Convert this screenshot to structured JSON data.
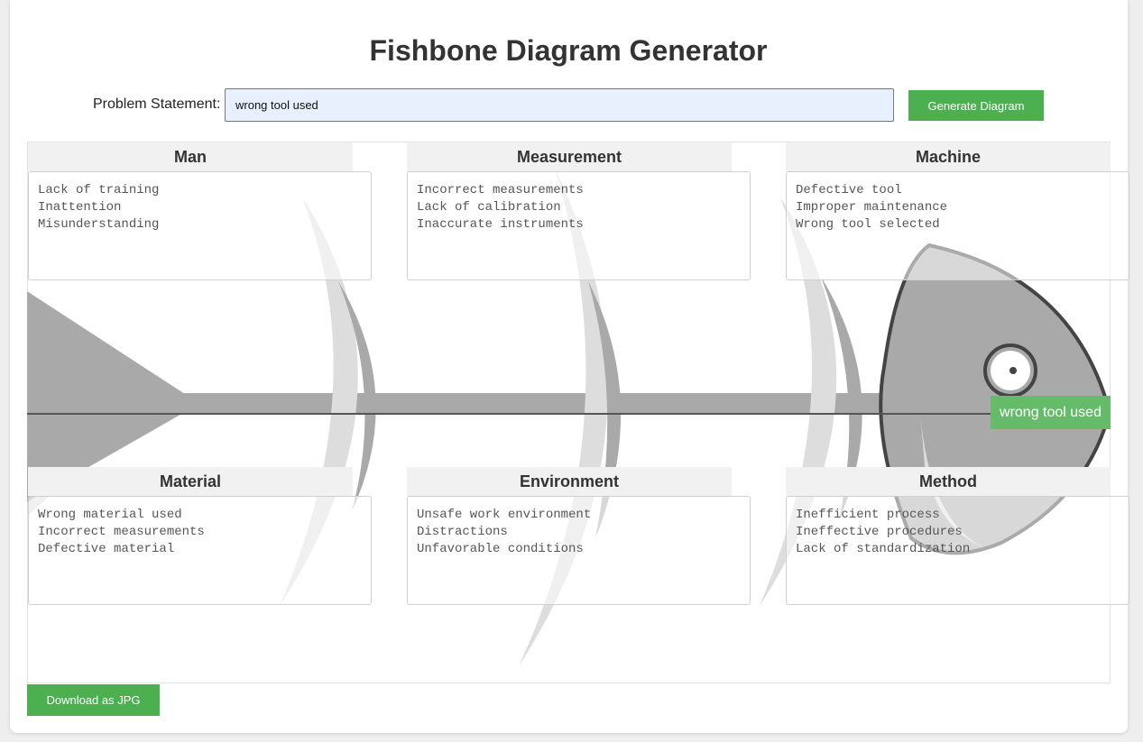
{
  "header": {
    "title": "Fishbone Diagram Generator"
  },
  "problem": {
    "label": "Problem Statement:",
    "value": "wrong tool used"
  },
  "buttons": {
    "generate": "Generate Diagram",
    "download": "Download as JPG"
  },
  "diagram": {
    "problem_label": "wrong tool used",
    "categories": [
      {
        "name": "Man",
        "causes": [
          "Lack of training",
          "Inattention",
          "Misunderstanding"
        ]
      },
      {
        "name": "Measurement",
        "causes": [
          "Incorrect measurements",
          "Lack of calibration",
          "Inaccurate instruments"
        ]
      },
      {
        "name": "Machine",
        "causes": [
          "Defective tool",
          "Improper maintenance",
          "Wrong tool selected"
        ]
      },
      {
        "name": "Material",
        "causes": [
          "Wrong material used",
          "Incorrect measurements",
          "Defective material"
        ]
      },
      {
        "name": "Environment",
        "causes": [
          "Unsafe work environment",
          "Distractions",
          "Unfavorable conditions"
        ]
      },
      {
        "name": "Method",
        "causes": [
          "Inefficient process",
          "Ineffective procedures",
          "Lack of standardization"
        ]
      }
    ]
  },
  "colors": {
    "accent": "#4caf50",
    "problem_badge": "#66bb6a",
    "fish_gray": "#a9a9a9",
    "fish_light": "#dddddd",
    "fish_outline": "#444444"
  }
}
